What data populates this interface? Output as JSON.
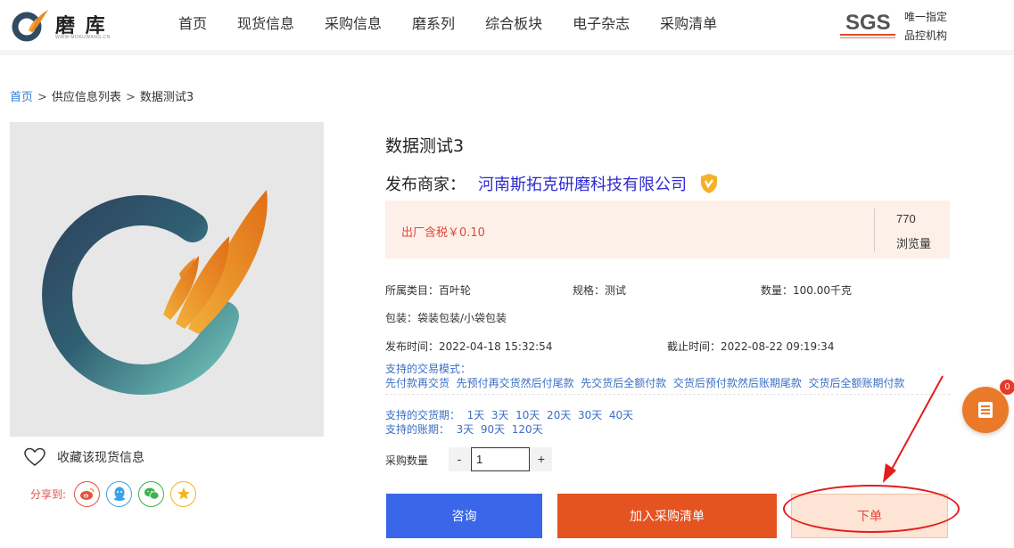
{
  "header": {
    "logo_text": "磨 库",
    "logo_sub": "WWW.MOKUWANG.CN",
    "nav": [
      "首页",
      "现货信息",
      "采购信息",
      "磨系列",
      "综合板块",
      "电子杂志",
      "采购清单"
    ],
    "sgs_text": "SGS",
    "sgs_slogan_line1": "唯一指定",
    "sgs_slogan_line2": "品控机构"
  },
  "breadcrumb": {
    "home": "首页",
    "list": "供应信息列表",
    "current": "数据测试3",
    "separator": ">"
  },
  "product": {
    "title": "数据测试3",
    "seller_label": "发布商家：",
    "seller_name": "河南斯拓克研磨科技有限公司",
    "price_text": "出厂含税￥0.10",
    "views_count": "770",
    "views_label": "浏览量",
    "category": "所属类目：百叶轮",
    "spec": "规格：测试",
    "quantity": "数量：100.00千克",
    "packaging": "包装：袋装包装/小袋包装",
    "publish_time": "发布时间：2022-04-18 15:32:54",
    "deadline": "截止时间：2022-08-22 09:19:34",
    "trade_modes_label": "支持的交易模式：",
    "trade_modes": "先付款再交货  先预付再交货然后付尾款  先交货后全额付款  交货后预付款然后账期尾款  交货后全额账期付款",
    "delivery_terms": "支持的交货期：  1天  3天  10天  20天  30天  40天",
    "payment_terms": "支持的账期：  3天  90天  120天"
  },
  "purchase": {
    "qty_label": "采购数量",
    "minus": "-",
    "plus": "+",
    "qty_value": "1"
  },
  "actions": {
    "favorite_label": "收藏该现货信息",
    "share_label": "分享到:",
    "consult": "咨询",
    "add_to_cart": "加入采购清单",
    "order": "下单"
  },
  "float_cart": {
    "badge": "0"
  },
  "colors": {
    "brand_blue": "#3a66ea",
    "brand_orange": "#e55321",
    "price_red": "#e2473d",
    "seller_blue": "#2d2bd0"
  },
  "icons": [
    "logo-mark-icon",
    "verified-shield-icon",
    "heart-icon",
    "weibo-icon",
    "qq-icon",
    "wechat-icon",
    "qzone-star-icon",
    "list-icon"
  ]
}
